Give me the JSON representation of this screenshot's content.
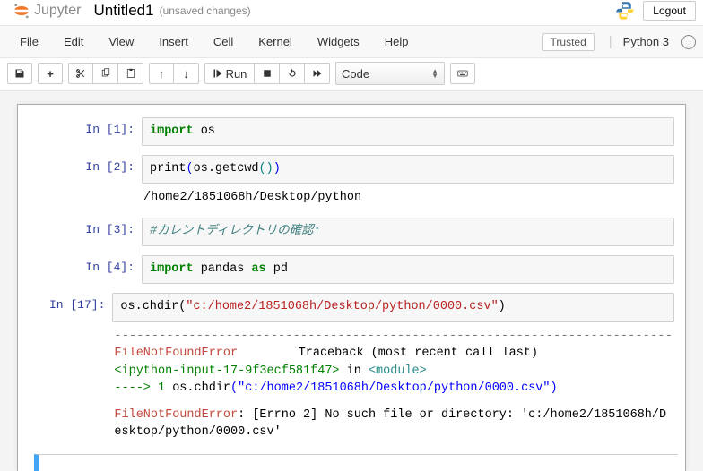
{
  "header": {
    "logo_text": "Jupyter",
    "title": "Untitled1",
    "title_status": "(unsaved changes)",
    "logout": "Logout"
  },
  "menu": {
    "items": [
      "File",
      "Edit",
      "View",
      "Insert",
      "Cell",
      "Kernel",
      "Widgets",
      "Help"
    ],
    "trusted": "Trusted",
    "kernel_name": "Python 3"
  },
  "toolbar": {
    "run_label": "Run",
    "celltype_selected": "Code"
  },
  "cells": [
    {
      "prompt": "In [1]:",
      "code_html": "<span class='c-green'>import</span> os"
    },
    {
      "prompt": "In [2]:",
      "code_html": "print<span class='c-blue'>(</span>os.getcwd<span class='c-teal'>()</span><span class='c-blue'>)</span>",
      "output_text": "/home2/1851068h/Desktop/python"
    },
    {
      "prompt": "In [3]:",
      "code_html": "<span class='c-comment'>#カレントディレクトリの確認↑</span>"
    },
    {
      "prompt": "In [4]:",
      "code_html": "<span class='c-green'>import</span> pandas <span class='c-green'>as</span> pd"
    },
    {
      "prompt": "In [17]:",
      "code_html": "os.chdir(<span class='c-red'>\"c:/home2/1851068h/Desktop/python/0000.csv\"</span>)",
      "error": {
        "dash": "---------------------------------------------------------------------------",
        "line1_left": "FileNotFoundError",
        "line1_right": "Traceback (most recent call last)",
        "line2_html": "<span class='c-greenn'>&lt;ipython-input-17-9f3ecf581f47&gt;</span> in <span class='c-darkcyan'>&lt;module&gt;</span>",
        "line3_html": "<span class='c-greenn'>----&gt; 1</span> os<span>.</span>chdir<span class='c-blue'>(\"c:/home2/1851068h/Desktop/python/0000.csv\")</span>",
        "line4_html": "<span class='c-err'>FileNotFoundError</span>: [Errno 2] No such file or directory: 'c:/home2/1851068h/Desktop/python/0000.csv'"
      }
    }
  ]
}
